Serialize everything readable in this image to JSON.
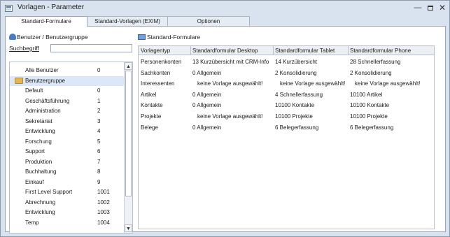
{
  "window": {
    "title": "Vorlagen - Parameter",
    "buttons": {
      "minimize": "—",
      "close": "✕"
    }
  },
  "tabs": [
    {
      "label": "Standard-Formulare",
      "active": true
    },
    {
      "label": "Standard-Vorlagen (EXIM)",
      "active": false
    },
    {
      "label": "Optionen",
      "active": false
    }
  ],
  "left": {
    "header": "Benutzer / Benutzergruppe",
    "search_label": "Suchbegriff",
    "search_value": "",
    "items": [
      {
        "name": "Alle Benutzer",
        "id": "0",
        "icon": "none",
        "selected": false
      },
      {
        "name": "Benutzergruppe",
        "id": "",
        "icon": "folder-icon",
        "selected": true
      },
      {
        "name": "Default",
        "id": "0",
        "icon": "none",
        "selected": false
      },
      {
        "name": "Geschäftsführung",
        "id": "1",
        "icon": "none",
        "selected": false
      },
      {
        "name": "Administration",
        "id": "2",
        "icon": "none",
        "selected": false
      },
      {
        "name": "Sekretariat",
        "id": "3",
        "icon": "none",
        "selected": false
      },
      {
        "name": "Entwicklung",
        "id": "4",
        "icon": "none",
        "selected": false
      },
      {
        "name": "Forschung",
        "id": "5",
        "icon": "none",
        "selected": false
      },
      {
        "name": "Support",
        "id": "6",
        "icon": "none",
        "selected": false
      },
      {
        "name": "Produktion",
        "id": "7",
        "icon": "none",
        "selected": false
      },
      {
        "name": "Buchhaltung",
        "id": "8",
        "icon": "none",
        "selected": false
      },
      {
        "name": "Einkauf",
        "id": "9",
        "icon": "none",
        "selected": false
      },
      {
        "name": "First Level Support",
        "id": "1001",
        "icon": "none",
        "selected": false
      },
      {
        "name": "Abrechnung",
        "id": "1002",
        "icon": "none",
        "selected": false
      },
      {
        "name": "Entwicklung",
        "id": "1003",
        "icon": "none",
        "selected": false
      },
      {
        "name": "Temp",
        "id": "1004",
        "icon": "none",
        "selected": false
      }
    ]
  },
  "right": {
    "header": "Standard-Formulare",
    "columns": [
      "Vorlagentyp",
      "Standardformular Desktop",
      "Standardformular Tablet",
      "Standardformular Phone"
    ],
    "rows": [
      {
        "type": "Personenkonten",
        "desktop": "13  Kurzübersicht mit CRM-Info",
        "tablet": "14  Kurzübersicht",
        "phone": "28  Schnellerfassung"
      },
      {
        "type": "Sachkonten",
        "desktop": "0  Allgemein",
        "tablet": "2  Konsolidierung",
        "phone": "2  Konsolidierung"
      },
      {
        "type": "Interessenten",
        "desktop": "keine Vorlage ausgewählt!",
        "tablet": "keine Vorlage ausgewählt!",
        "phone": "keine Vorlage ausgewählt!"
      },
      {
        "type": "Artikel",
        "desktop": "0  Allgemein",
        "tablet": "4  Schnellerfassung",
        "phone": "10100  Artikel"
      },
      {
        "type": "Kontakte",
        "desktop": "0  Allgemein",
        "tablet": "10100  Kontakte",
        "phone": "10100  Kontakte"
      },
      {
        "type": "Projekte",
        "desktop": "keine Vorlage ausgewählt!",
        "tablet": "10100  Projekte",
        "phone": "10100  Projekte"
      },
      {
        "type": "Belege",
        "desktop": "0  Allgemein",
        "tablet": "6  Belegerfassung",
        "phone": "6  Belegerfassung"
      }
    ]
  },
  "colors": {
    "chrome": "#d9e3f0",
    "selected_row": "#dce8f7",
    "border": "#9aa6b8"
  }
}
